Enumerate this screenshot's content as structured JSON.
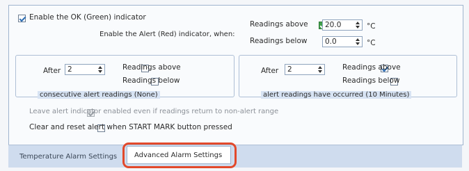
{
  "ok_indicator": {
    "label": "Enable the OK (Green) indicator",
    "checked": true
  },
  "alert_indicator": {
    "label": "Enable the Alert (Red) indicator, when:"
  },
  "readings_above": {
    "label": "Readings above",
    "checked": true,
    "value": "20.0",
    "unit": "°C"
  },
  "readings_below": {
    "label": "Readings below",
    "checked": true,
    "value": "0.0",
    "unit": "°C"
  },
  "left_group": {
    "after_label": "After",
    "after_value": "2",
    "above_label": "Readings above",
    "above_checked": false,
    "below_label": "Readings below",
    "below_checked": false,
    "caption": "consecutive alert readings (None)"
  },
  "right_group": {
    "after_label": "After",
    "after_value": "2",
    "above_label": "Readings above",
    "above_checked": true,
    "below_label": "Readings below",
    "below_checked": false,
    "caption": "alert readings have occurred (10 Minutes)"
  },
  "leave_alert": {
    "label": "Leave alert indicator enabled even if readings return to non-alert range",
    "checked": true,
    "disabled": true
  },
  "clear_reset": {
    "label": "Clear and reset alert when START MARK button pressed",
    "checked": false
  },
  "tabs": [
    {
      "label": "Temperature Alarm Settings",
      "active": false
    },
    {
      "label": "Advanced Alarm Settings",
      "active": true
    }
  ],
  "colors": {
    "highlight": "#e2492b",
    "checkbox_green": "#3f9f4a"
  }
}
